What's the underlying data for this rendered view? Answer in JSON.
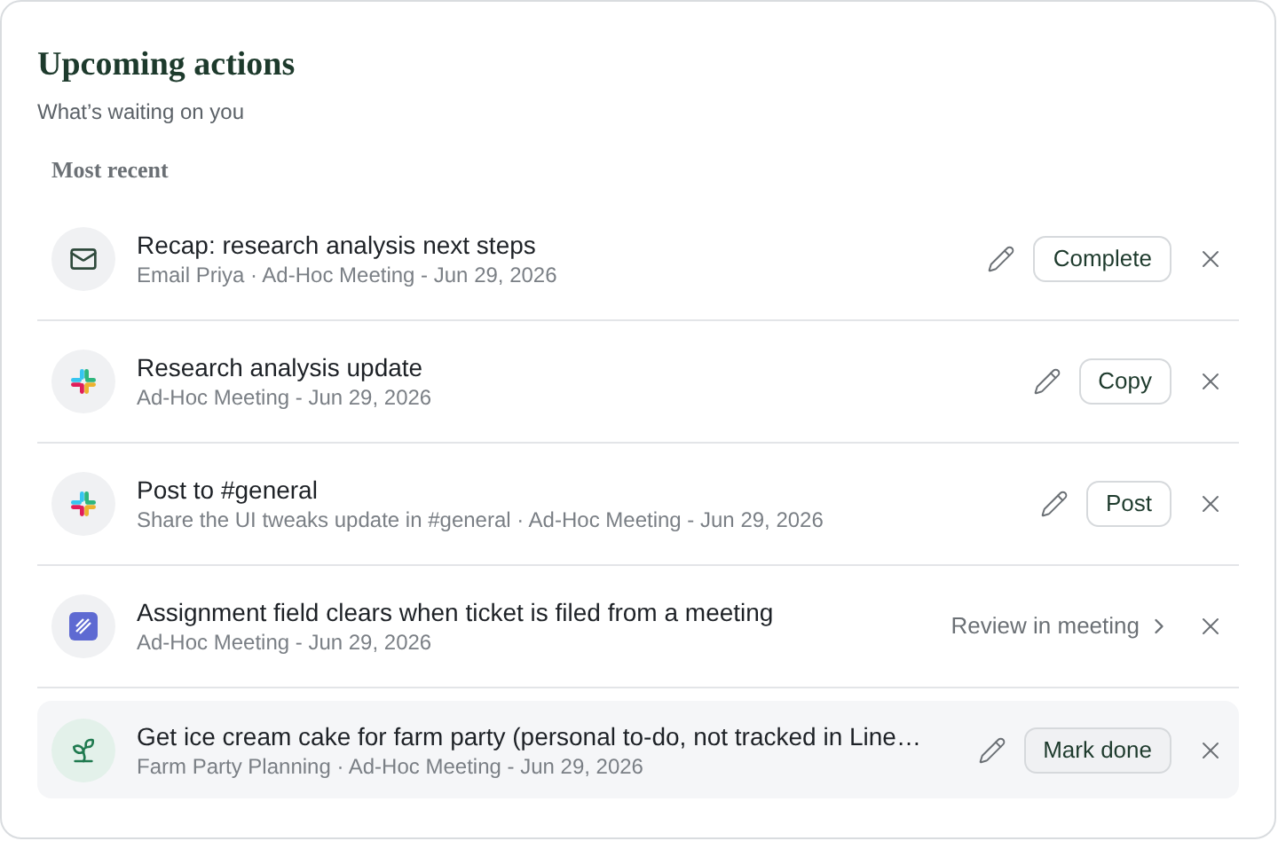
{
  "header": {
    "title": "Upcoming actions",
    "subtitle": "What’s waiting on you"
  },
  "section": {
    "label": "Most recent"
  },
  "items": [
    {
      "kind": "email",
      "title": "Recap: research analysis next steps",
      "meta": "Email Priya · Ad-Hoc Meeting - Jun 29, 2026",
      "editable": true,
      "action": {
        "kind": "button",
        "label": "Complete"
      },
      "highlighted": false
    },
    {
      "kind": "slack",
      "title": "Research analysis update",
      "meta": "Ad-Hoc Meeting - Jun 29, 2026",
      "editable": true,
      "action": {
        "kind": "button",
        "label": "Copy"
      },
      "highlighted": false
    },
    {
      "kind": "slack",
      "title": "Post to #general",
      "meta": "Share the UI tweaks update in #general · Ad-Hoc Meeting - Jun 29, 2026",
      "editable": true,
      "action": {
        "kind": "button",
        "label": "Post"
      },
      "highlighted": false
    },
    {
      "kind": "linear",
      "title": "Assignment field clears when ticket is filed from a meeting",
      "meta": "Ad-Hoc Meeting - Jun 29, 2026",
      "editable": false,
      "action": {
        "kind": "link",
        "label": "Review in meeting"
      },
      "highlighted": false
    },
    {
      "kind": "sprout",
      "title": "Get ice cream cake for farm party (personal to-do, not tracked in Line…",
      "meta": "Farm Party Planning · Ad-Hoc Meeting - Jun 29, 2026",
      "editable": true,
      "action": {
        "kind": "button",
        "label": "Mark done"
      },
      "highlighted": true
    }
  ]
}
